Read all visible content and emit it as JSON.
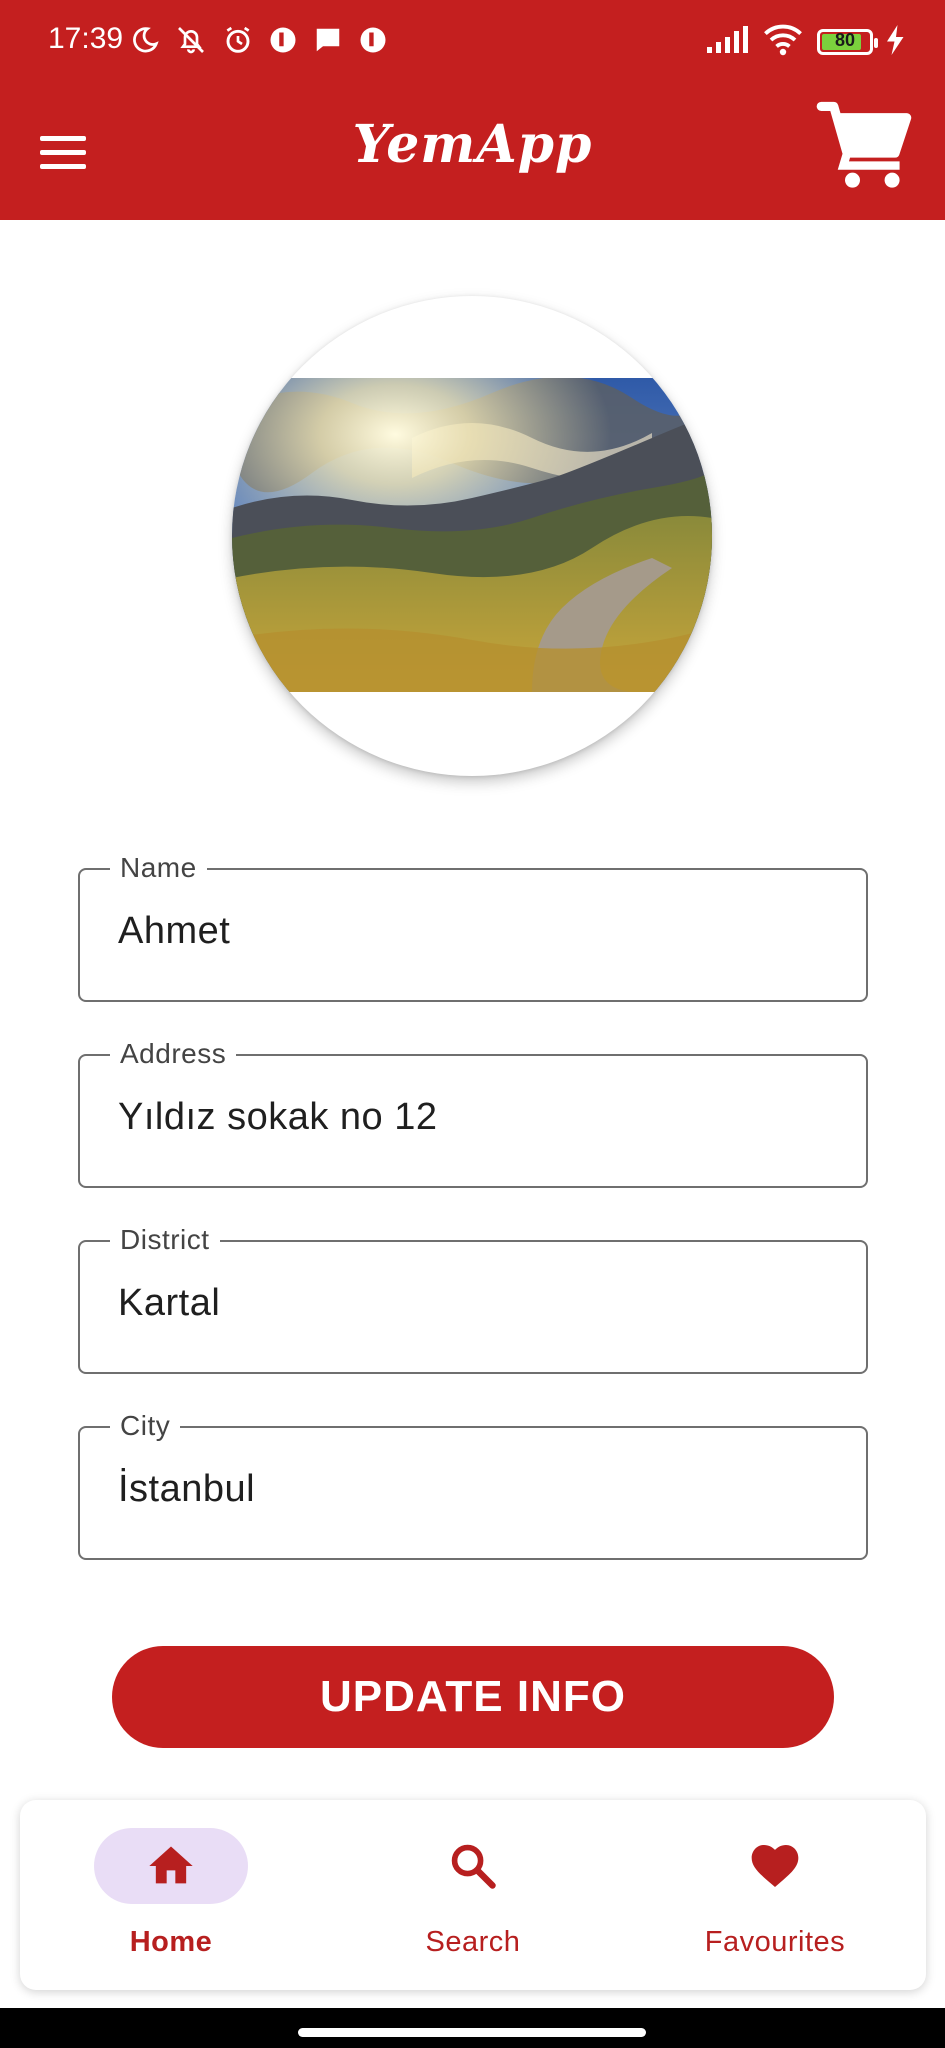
{
  "status_bar": {
    "time": "17:39",
    "battery_level": "80",
    "icons_left": [
      "moon-icon",
      "bell-off-icon",
      "alarm-icon",
      "app-icon",
      "message-icon",
      "app-icon"
    ],
    "icons_right": [
      "signal-icon",
      "wifi-icon",
      "battery-icon",
      "charging-icon"
    ]
  },
  "app_bar": {
    "title": "YemApp",
    "color": "#c41f1f",
    "menu_icon": "menu-icon",
    "cart_icon": "cart-icon"
  },
  "profile": {
    "avatar_icon": "avatar-image"
  },
  "form": {
    "name": {
      "label": "Name",
      "value": "Ahmet"
    },
    "address": {
      "label": "Address",
      "value": "Yıldız sokak no 12"
    },
    "district": {
      "label": "District",
      "value": "Kartal"
    },
    "city": {
      "label": "City",
      "value": "İstanbul"
    }
  },
  "update_button": {
    "label": "UPDATE INFO"
  },
  "bottom_nav": {
    "items": [
      {
        "label": "Home",
        "icon": "home-icon",
        "active": true
      },
      {
        "label": "Search",
        "icon": "search-icon",
        "active": false
      },
      {
        "label": "Favourites",
        "icon": "heart-icon",
        "active": false
      }
    ]
  }
}
